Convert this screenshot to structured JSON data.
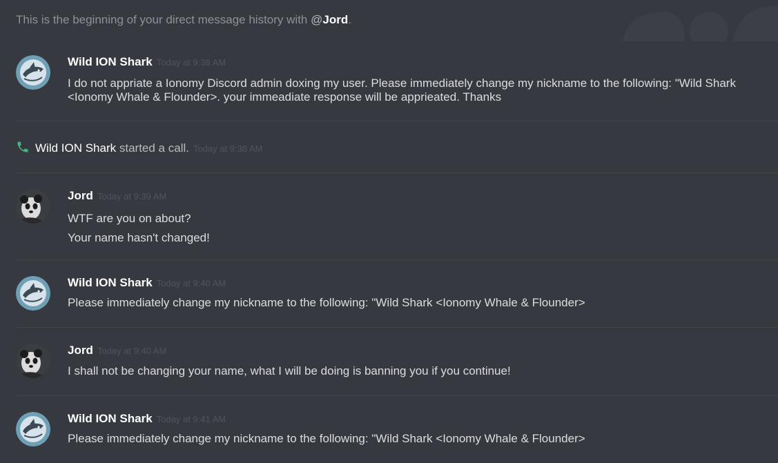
{
  "intro": {
    "prefix": "This is the beginning of your direct message history with ",
    "mention": "@",
    "mention_name": "Jord",
    "suffix": "."
  },
  "messages": [
    {
      "author": "Wild ION Shark",
      "avatar_icon": "shark-avatar-icon",
      "timestamp": "Today at 9:38 AM",
      "lines": [
        "I do not appriate  a Ionomy Discord admin doxing my user. Please immediately change my nickname to the following: \"Wild Shark <Ionomy Whale & Flounder>. your immeadiate response will be apprieated. Thanks"
      ]
    },
    {
      "author": "Jord",
      "avatar_icon": "panda-avatar-icon",
      "timestamp": "Today at 9:39 AM",
      "lines": [
        "WTF are you on about?",
        "Your name hasn't changed!"
      ]
    },
    {
      "author": "Wild ION Shark",
      "avatar_icon": "shark-avatar-icon",
      "timestamp": "Today at 9:40 AM",
      "lines": [
        "Please immediately change my nickname to the following: \"Wild Shark <Ionomy Whale & Flounder>"
      ]
    },
    {
      "author": "Jord",
      "avatar_icon": "panda-avatar-icon",
      "timestamp": "Today at 9:40 AM",
      "lines": [
        "I shall not be changing your name, what I will be doing is banning you if you continue!"
      ]
    },
    {
      "author": "Wild ION Shark",
      "avatar_icon": "shark-avatar-icon",
      "timestamp": "Today at 9:41 AM",
      "lines": [
        "Please immediately change my nickname to the following: \"Wild Shark <Ionomy Whale & Flounder>"
      ]
    }
  ],
  "call": {
    "icon": "phone-icon",
    "caller": "Wild ION Shark",
    "action": " started a call.",
    "timestamp": "Today at 9:38 AM"
  },
  "colors": {
    "background": "#36393f",
    "username": "#ffffff",
    "message_text": "#dcddde",
    "timestamp": "#4f545c",
    "call_icon": "#43b581"
  }
}
